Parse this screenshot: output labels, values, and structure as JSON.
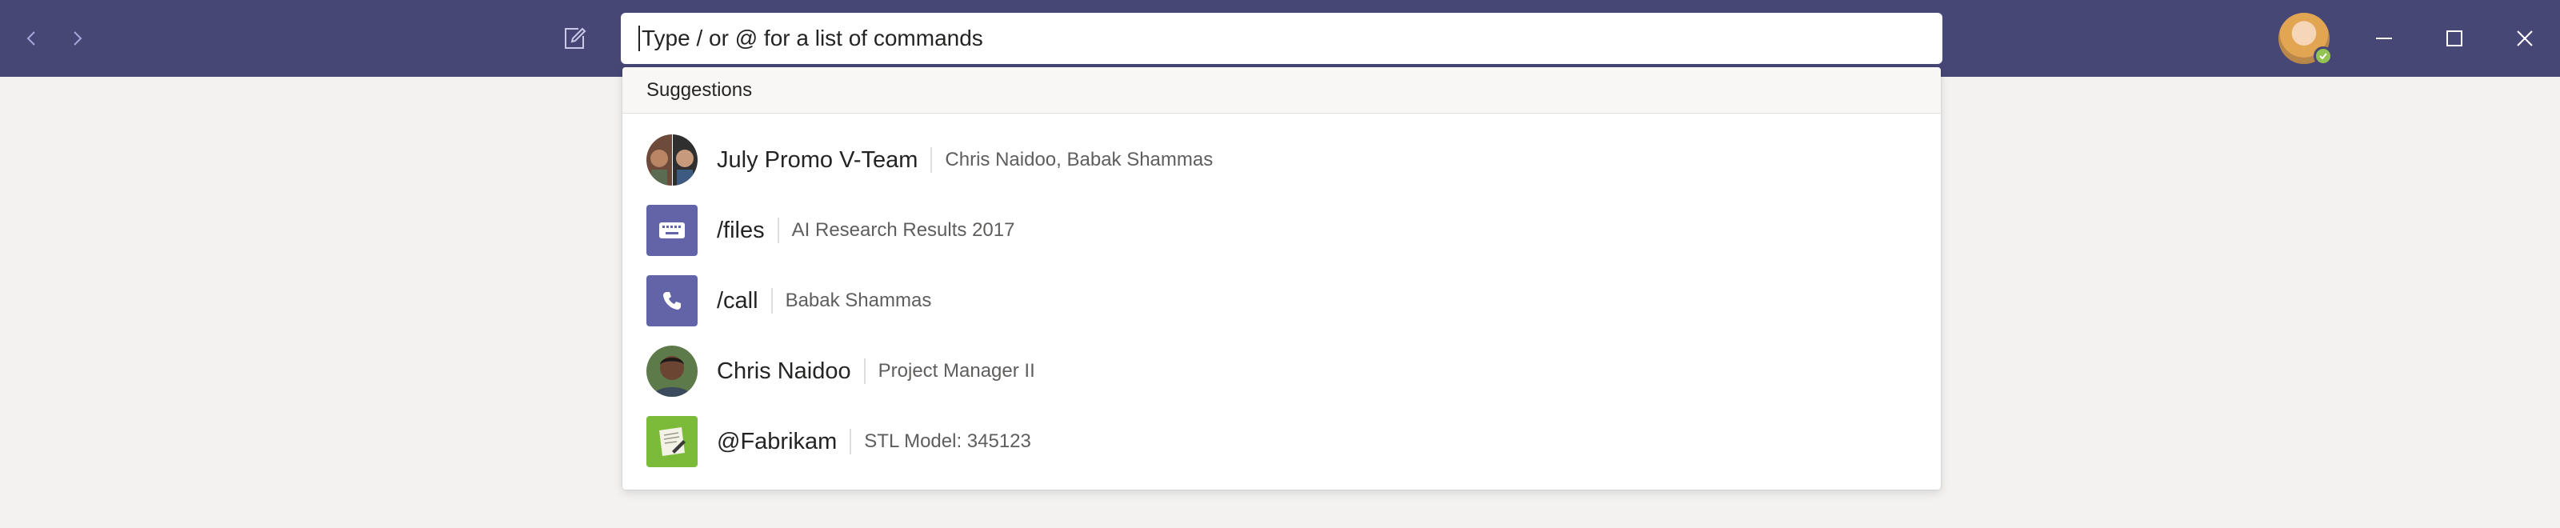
{
  "colors": {
    "titlebar": "#464775",
    "accent": "#6264a7",
    "app_icon_green": "#7cbb3a",
    "presence_available": "#92c353",
    "background": "#f3f2f1"
  },
  "titlebar": {
    "back_icon": "chevron-left-icon",
    "forward_icon": "chevron-right-icon",
    "compose_icon": "compose-icon",
    "search": {
      "value": "",
      "placeholder": "Type / or @ for a list of commands"
    },
    "user_presence": "available",
    "window_controls": [
      "minimize-icon",
      "maximize-icon",
      "close-icon"
    ]
  },
  "suggestions": {
    "header": "Suggestions",
    "items": [
      {
        "title": "July Promo V-Team",
        "subtitle": "Chris Naidoo, Babak Shammas",
        "icon": "group-avatar"
      },
      {
        "title": "/files",
        "subtitle": "AI Research Results 2017",
        "icon": "keyboard-icon"
      },
      {
        "title": "/call",
        "subtitle": "Babak Shammas",
        "icon": "phone-icon"
      },
      {
        "title": "Chris Naidoo",
        "subtitle": "Project Manager II",
        "icon": "person-avatar"
      },
      {
        "title": "@Fabrikam",
        "subtitle": "STL Model: 345123",
        "icon": "app-icon"
      }
    ]
  }
}
